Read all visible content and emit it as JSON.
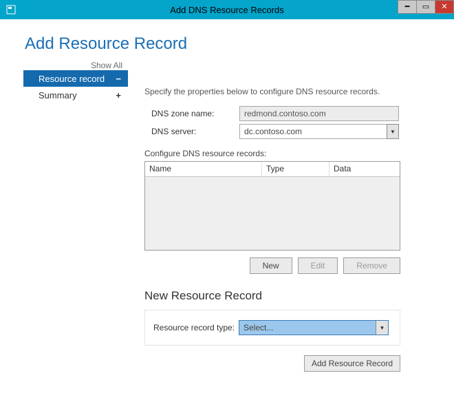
{
  "window": {
    "title": "Add DNS Resource Records"
  },
  "heading": "Add Resource Record",
  "sidebar": {
    "show_all": "Show All",
    "items": [
      {
        "label": "Resource record",
        "expander": "−",
        "selected": true
      },
      {
        "label": "Summary",
        "expander": "+",
        "selected": false
      }
    ]
  },
  "intro": "Specify the properties below to configure DNS resource records.",
  "fields": {
    "zone_label": "DNS zone name:",
    "zone_value": "redmond.contoso.com",
    "server_label": "DNS server:",
    "server_value": "dc.contoso.com"
  },
  "configure_label": "Configure DNS resource records:",
  "grid": {
    "cols": {
      "name": "Name",
      "type": "Type",
      "data": "Data"
    },
    "rows": []
  },
  "buttons": {
    "new": "New",
    "edit": "Edit",
    "remove": "Remove"
  },
  "new_record": {
    "heading": "New Resource Record",
    "type_label": "Resource record type:",
    "type_value": "Select..."
  },
  "footer": {
    "add": "Add Resource Record"
  }
}
